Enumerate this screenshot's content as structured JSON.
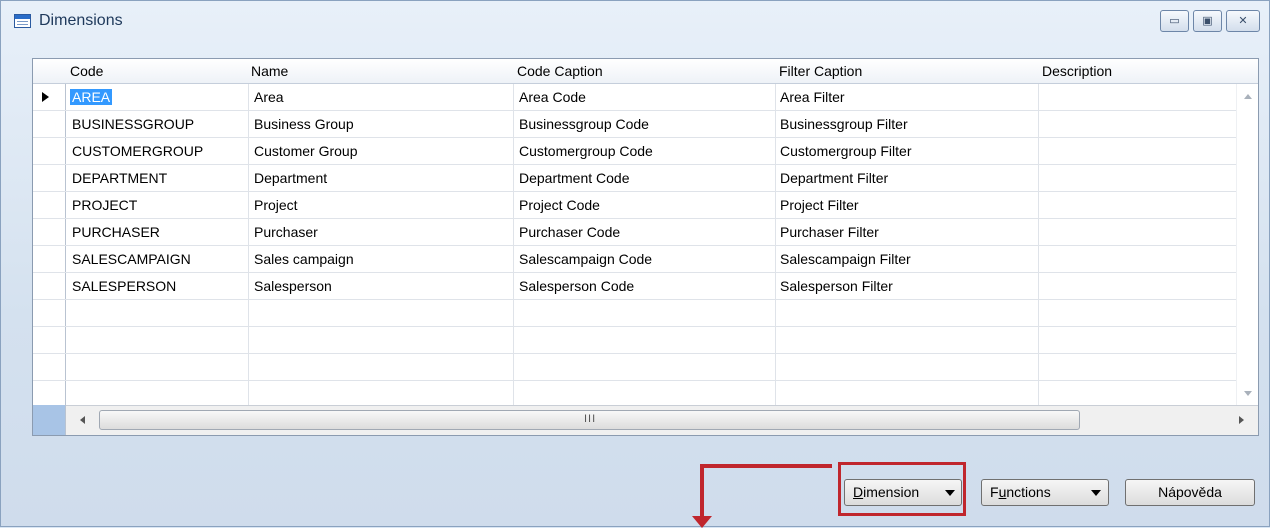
{
  "window": {
    "title": "Dimensions",
    "controls": {
      "minimize": "▭",
      "maximize": "▣",
      "close": "✕"
    }
  },
  "grid": {
    "columns": [
      "Code",
      "Name",
      "Code Caption",
      "Filter Caption",
      "Description"
    ],
    "rows": [
      [
        "AREA",
        "Area",
        "Area Code",
        "Area Filter",
        ""
      ],
      [
        "BUSINESSGROUP",
        "Business Group",
        "Businessgroup Code",
        "Businessgroup Filter",
        ""
      ],
      [
        "CUSTOMERGROUP",
        "Customer Group",
        "Customergroup Code",
        "Customergroup Filter",
        ""
      ],
      [
        "DEPARTMENT",
        "Department",
        "Department Code",
        "Department Filter",
        ""
      ],
      [
        "PROJECT",
        "Project",
        "Project Code",
        "Project Filter",
        ""
      ],
      [
        "PURCHASER",
        "Purchaser",
        "Purchaser Code",
        "Purchaser Filter",
        ""
      ],
      [
        "SALESCAMPAIGN",
        "Sales campaign",
        "Salescampaign Code",
        "Salescampaign Filter",
        ""
      ],
      [
        "SALESPERSON",
        "Salesperson",
        "Salesperson Code",
        "Salesperson Filter",
        ""
      ]
    ],
    "hscroll_grip": "III"
  },
  "buttons": {
    "dimension": {
      "mnemonic": "D",
      "rest": "imension"
    },
    "functions": {
      "pre": "F",
      "mnemonic": "u",
      "rest": "nctions"
    },
    "help": "Nápověda"
  },
  "annotation_color": "#c0262d"
}
